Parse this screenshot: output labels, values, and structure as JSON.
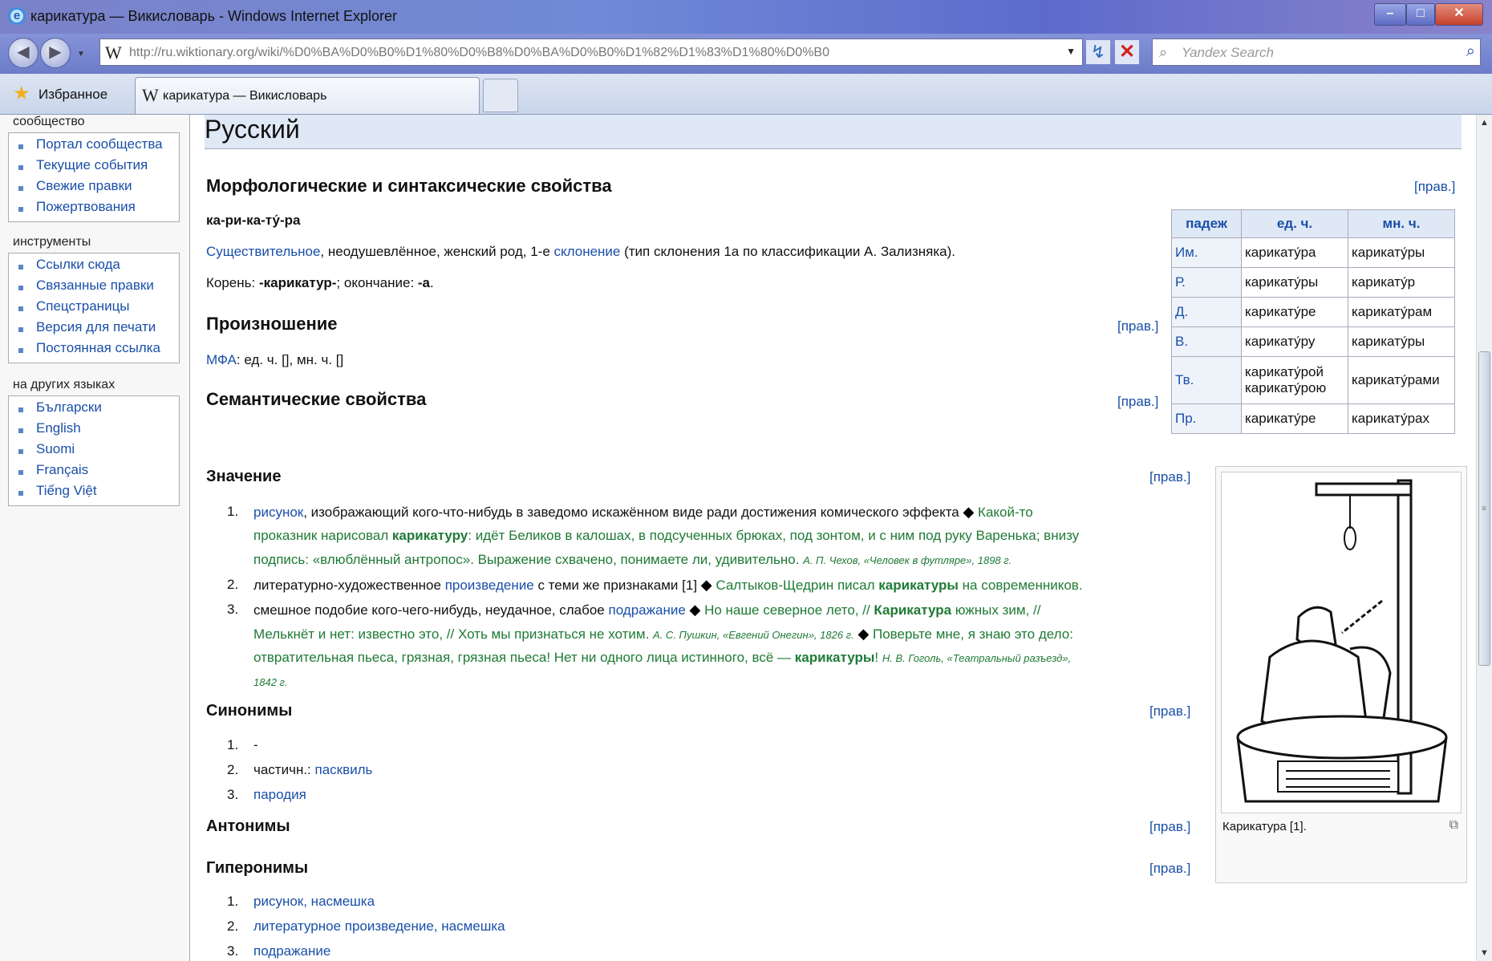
{
  "window": {
    "title": "карикатура — Викисловарь - Windows Internet Explorer",
    "min": "–",
    "max": "□",
    "close": "✕"
  },
  "nav": {
    "url": "http://ru.wiktionary.org/wiki/%D0%BA%D0%B0%D1%80%D0%B8%D0%BA%D0%B0%D1%82%D1%83%D1%80%D0%B0",
    "w_icon": "W",
    "search_placeholder": "Yandex Search",
    "back_glyph": "◀",
    "fwd_glyph": "▶",
    "drop": "▼",
    "refresh": "↯",
    "stop": "✕",
    "lens": "⌕"
  },
  "tabs": {
    "favorites": "Избранное",
    "active_tab": "карикатура — Викисловарь"
  },
  "sidebar": {
    "community_header": "сообщество",
    "community": [
      "Портал сообщества",
      "Текущие события",
      "Свежие правки",
      "Пожертвования"
    ],
    "tools_header": "инструменты",
    "tools": [
      "Ссылки сюда",
      "Связанные правки",
      "Спецстраницы",
      "Версия для печати",
      "Постоянная ссылка"
    ],
    "langs_header": "на других языках",
    "langs": [
      "Български",
      "English",
      "Suomi",
      "Français",
      "Tiếng Việt"
    ]
  },
  "article": {
    "lang_heading": "Русский",
    "edit_label": "[прав.]",
    "morph_heading": "Морфологические и синтаксические свойства",
    "syllables": "ка-ри-ка-ту́-ра",
    "pos_link": "Существительное",
    "pos_text": ", неодушевлённое, женский род, 1-е ",
    "decl_link": "склонение",
    "decl_text": " (тип склонения 1a по классификации А. Зализняка).",
    "root_prefix": "Корень: ",
    "root": "-карикатур-",
    "root_mid": "; окончание: ",
    "ending": "-а",
    "pron_heading": "Произношение",
    "ipa_link": "МФА",
    "ipa_text": ": ед. ч. [], мн. ч. []",
    "sem_heading": "Семантические свойства",
    "meaning_heading": "Значение",
    "m1_link": "рисунок",
    "m1_text": ", изображающий кого-что-нибудь в заведомо искажённом виде ради достижения комического эффекта ",
    "m1_ex_a": "Какой-то",
    "m1_ex_b": "проказник нарисовал ",
    "m1_ex_bold": "карикатуру",
    "m1_ex_c": ": идёт Беликов в калошах, в подсученных брюках, под зонтом, и с ним под руку Варенька; внизу",
    "m1_ex_d": "подпись: «влюблённый антропос». Выражение схвачено, понимаете ли, удивительно. ",
    "m1_src": "А. П. Чехов, «Человек в футляре», 1898 г.",
    "m2_text": "литературно-художественное ",
    "m2_link": "произведение",
    "m2_text2": " с теми же признаками [1] ",
    "m2_ex_a": "Салтыков-Щедрин писал ",
    "m2_ex_bold": "карикатуры",
    "m2_ex_b": " на современников.",
    "m3_text": "смешное подобие кого-чего-нибудь, неудачное, слабое ",
    "m3_link": "подражание",
    "m3_ex_a": " Но наше северное лето, // ",
    "m3_ex_bold": "Карикатура",
    "m3_ex_b": " южных зим, //",
    "m3_ex_c": "Мелькнёт и нет: известно это, // Хоть мы признаться не хотим. ",
    "m3_src1": "А. С. Пушкин, «Евгений Онегин», 1826 г.",
    "m3_ex_d": " Поверьте мне, я знаю это дело:",
    "m3_ex_e": "отвратительная пьеса, грязная, грязная пьеса! Нет ни одного лица истинного, всё — ",
    "m3_ex_bold2": "карикатуры",
    "m3_ex_f": "! ",
    "m3_src2": "Н. В. Гоголь, «Театральный разъезд»,",
    "m3_src3": "1842 г.",
    "diamond": "◆",
    "syn_heading": "Синонимы",
    "syn1": "-",
    "syn2_text": "частичн.: ",
    "syn2_link": "пасквиль",
    "syn3_link": "пародия",
    "ant_heading": "Антонимы",
    "hyp_heading": "Гиперонимы",
    "hyp1": "рисунок, насмешка",
    "hyp2": "литературное произведение, насмешка",
    "hyp3": "подражание",
    "nums": [
      "1.",
      "2.",
      "3."
    ],
    "image_caption": "Карикатура [1].",
    "magnify": "⧉"
  },
  "declension": {
    "headers": [
      "падеж",
      "ед. ч.",
      "мн. ч."
    ],
    "rows": [
      {
        "case": "Им.",
        "sg": "карикату́ра",
        "pl": "карикату́ры"
      },
      {
        "case": "Р.",
        "sg": "карикату́ры",
        "pl": "карикату́р"
      },
      {
        "case": "Д.",
        "sg": "карикату́ре",
        "pl": "карикату́рам"
      },
      {
        "case": "В.",
        "sg": "карикату́ру",
        "pl": "карикату́ры"
      },
      {
        "case": "Тв.",
        "sg": "карикату́рой",
        "sg2": "карикату́рою",
        "pl": "карикату́рами"
      },
      {
        "case": "Пр.",
        "sg": "карикату́ре",
        "pl": "карикату́рах"
      }
    ]
  },
  "colors": {
    "link": "#1a4fa8",
    "example": "#1f7a36",
    "heading_bg": "#dfe8f5"
  }
}
